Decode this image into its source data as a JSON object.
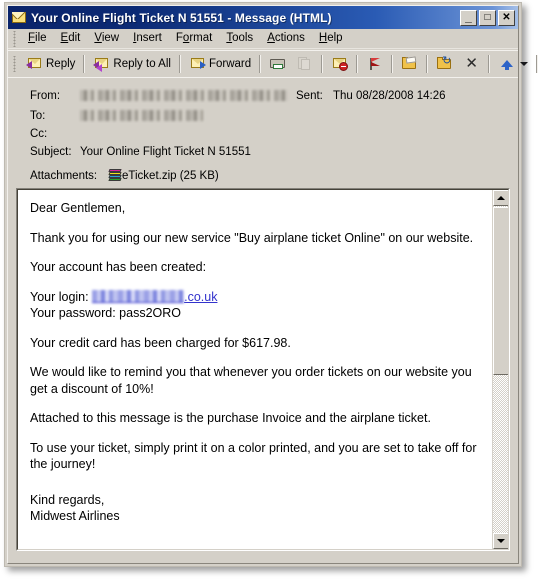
{
  "window": {
    "title": "Your Online Flight Ticket N 51551 - Message (HTML)",
    "icon": "envelope-icon",
    "minimize_label": "_",
    "maximize_label": "□",
    "close_label": "✕"
  },
  "menubar": {
    "items": [
      {
        "label": "File",
        "accel": "F"
      },
      {
        "label": "Edit",
        "accel": "E"
      },
      {
        "label": "View",
        "accel": "V"
      },
      {
        "label": "Insert",
        "accel": "I"
      },
      {
        "label": "Format",
        "accel": "o"
      },
      {
        "label": "Tools",
        "accel": "T"
      },
      {
        "label": "Actions",
        "accel": "A"
      },
      {
        "label": "Help",
        "accel": "H"
      }
    ]
  },
  "toolbar": {
    "reply_label": "Reply",
    "reply_all_label": "Reply to All",
    "forward_label": "Forward",
    "print_icon": "printer-icon",
    "copy_icon": "copy-icon",
    "junk_icon": "block-sender-icon",
    "flag_icon": "flag-icon",
    "open_folder_icon": "open-folder-icon",
    "move_folder_icon": "move-to-folder-icon",
    "delete_icon": "delete-icon",
    "up_arrow_icon": "previous-item-icon",
    "dropdown_icon": "chevron-down-icon",
    "help_icon": "help-icon",
    "overflow_icon": "toolbar-overflow-icon",
    "help_glyph": "?"
  },
  "headers": {
    "from_label": "From:",
    "from_value": "",
    "to_label": "To:",
    "to_value": "",
    "cc_label": "Cc:",
    "cc_value": "",
    "subject_label": "Subject:",
    "subject_value": "Your Online Flight Ticket N 51551",
    "sent_label": "Sent:",
    "sent_value": "Thu 08/28/2008 14:26",
    "attachments_label": "Attachments:",
    "attachment_name": "eTicket.zip (25 KB)",
    "attachment_icon": "zip-archive-icon"
  },
  "body": {
    "greeting": "Dear Gentlemen,",
    "p1": "Thank you for using our new service \"Buy airplane ticket Online\" on our website.",
    "p2": "Your account has been created:",
    "login_label": "Your login:",
    "login_domain": ".co.uk",
    "password_line": "Your password: pass2ORO",
    "p3": "Your credit card has been charged for $617.98.",
    "p4": "We would like to remind you that whenever you order tickets on our website you get a discount of 10%!",
    "p5": "Attached to this message is the purchase Invoice and the airplane ticket.",
    "p6": "To use your ticket, simply print it on a color printed, and you are set to take off for the journey!",
    "signoff": "Kind regards,",
    "signature": "Midwest Airlines"
  },
  "scrollbar": {
    "up_label": "▲",
    "down_label": "▼"
  },
  "colors": {
    "titlebar_start": "#0a246a",
    "titlebar_end": "#a6c0e8",
    "chrome": "#d4d0c8",
    "link": "#3333cc",
    "body_bg": "#ffffff"
  }
}
